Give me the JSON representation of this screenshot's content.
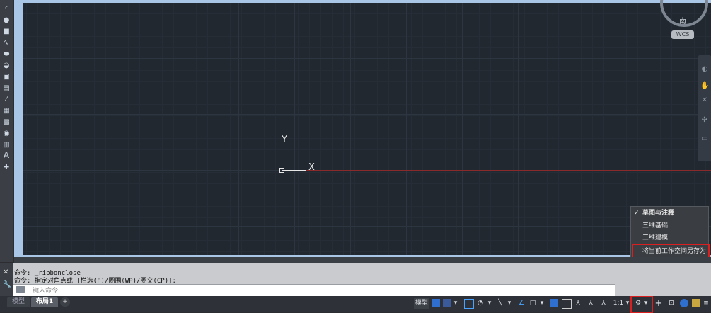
{
  "canvas": {
    "axis_y_label": "Y",
    "axis_x_label": "X",
    "compass_direction": "南",
    "coordinate_system_badge": "WCS"
  },
  "toolbar_left": {
    "tools": [
      "arc-icon",
      "circle-icon",
      "polygon-icon",
      "spline-icon",
      "ellipse-icon",
      "ellipse-arc-icon",
      "insert-block-icon",
      "make-block-icon",
      "point-icon",
      "hatch-icon",
      "gradient-icon",
      "region-icon",
      "table-icon",
      "text-icon",
      "add-selected-icon"
    ],
    "text_tool_glyph": "A"
  },
  "workspace_menu": {
    "items": [
      {
        "label": "草图与注释",
        "checked": true
      },
      {
        "label": "三维基础",
        "checked": false
      },
      {
        "label": "三维建模",
        "checked": false
      },
      {
        "label": "将当前工作空间另存为...",
        "checked": false
      }
    ],
    "check_glyph": "✓"
  },
  "command": {
    "history": [
      "命令: _ribbonclose",
      "命令: 指定对角点或 [栏选(F)/圈围(WP)/圈交(CP)]:"
    ],
    "placeholder": "键入命令"
  },
  "layout_tabs": {
    "model": "模型",
    "layout1": "布局1",
    "add": "+"
  },
  "status_bar": {
    "model_label": "模型",
    "annotation_scale": "1:1",
    "dropdown_glyph": "▾"
  },
  "colors": {
    "canvas_bg": "#212830",
    "highlight_red": "#d82020",
    "y_axis": "#3a8a3a",
    "x_axis": "#8a2a2a"
  }
}
